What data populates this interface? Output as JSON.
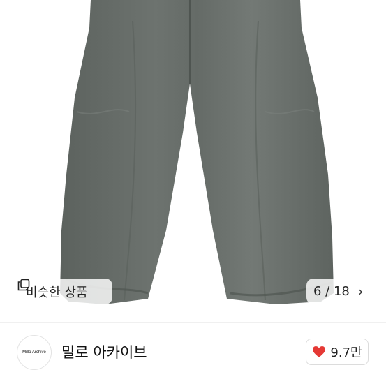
{
  "photo": {
    "similar_label": "비슷한 상품",
    "counter": "6 / 18",
    "next_icon": "chevron-right-icon",
    "similar_icon": "copy-icon"
  },
  "shop": {
    "avatar_text": "Millo Archive",
    "name": "밀로 아카이브",
    "like_count": "9.7만",
    "like_icon": "heart-icon",
    "like_color": "#e53935"
  }
}
